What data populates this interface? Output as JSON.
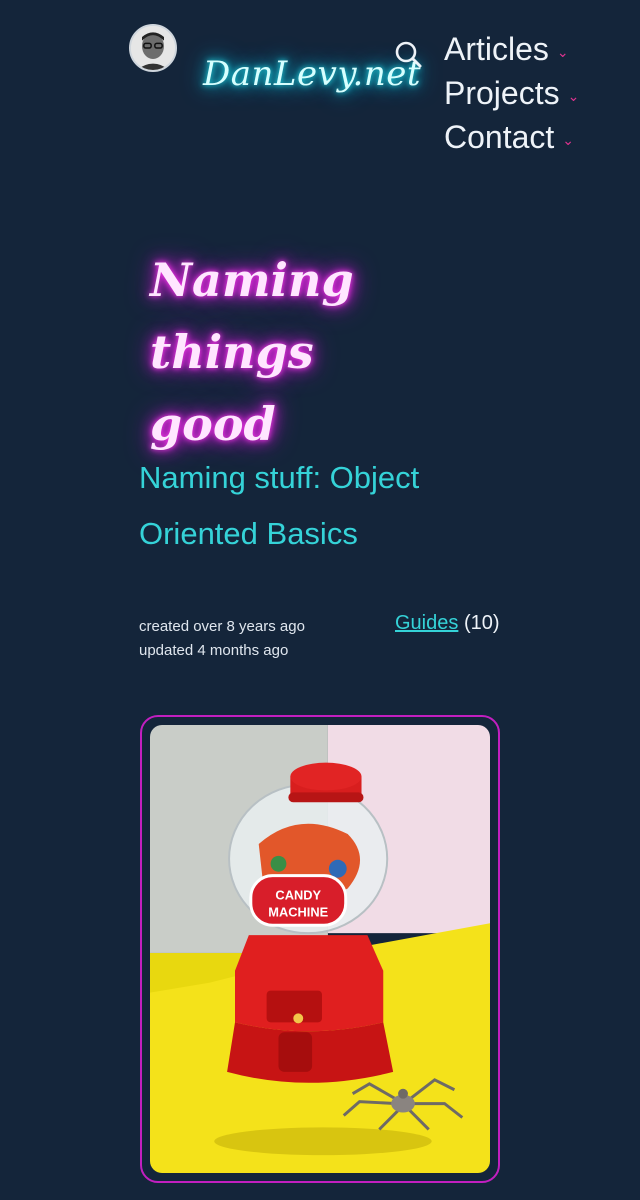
{
  "header": {
    "logo_text": "DanLevy.net",
    "nav": [
      {
        "label": "Articles"
      },
      {
        "label": "Projects"
      },
      {
        "label": "Contact"
      }
    ]
  },
  "post": {
    "title_line1": "Naming",
    "title_line2": "things good",
    "subtitle_line1": "Naming stuff: Object",
    "subtitle_line2": "Oriented Basics",
    "created": "created over 8 years ago",
    "updated": "updated 4 months ago",
    "category": "Guides",
    "category_count": "(10)",
    "image_label_line1": "CANDY",
    "image_label_line2": "MACHINE"
  },
  "colors": {
    "background": "#14253a",
    "logo_glow": "#22e5f0",
    "title_glow": "#e020e0",
    "accent": "#35d3d8",
    "chevron": "#e0338f"
  }
}
